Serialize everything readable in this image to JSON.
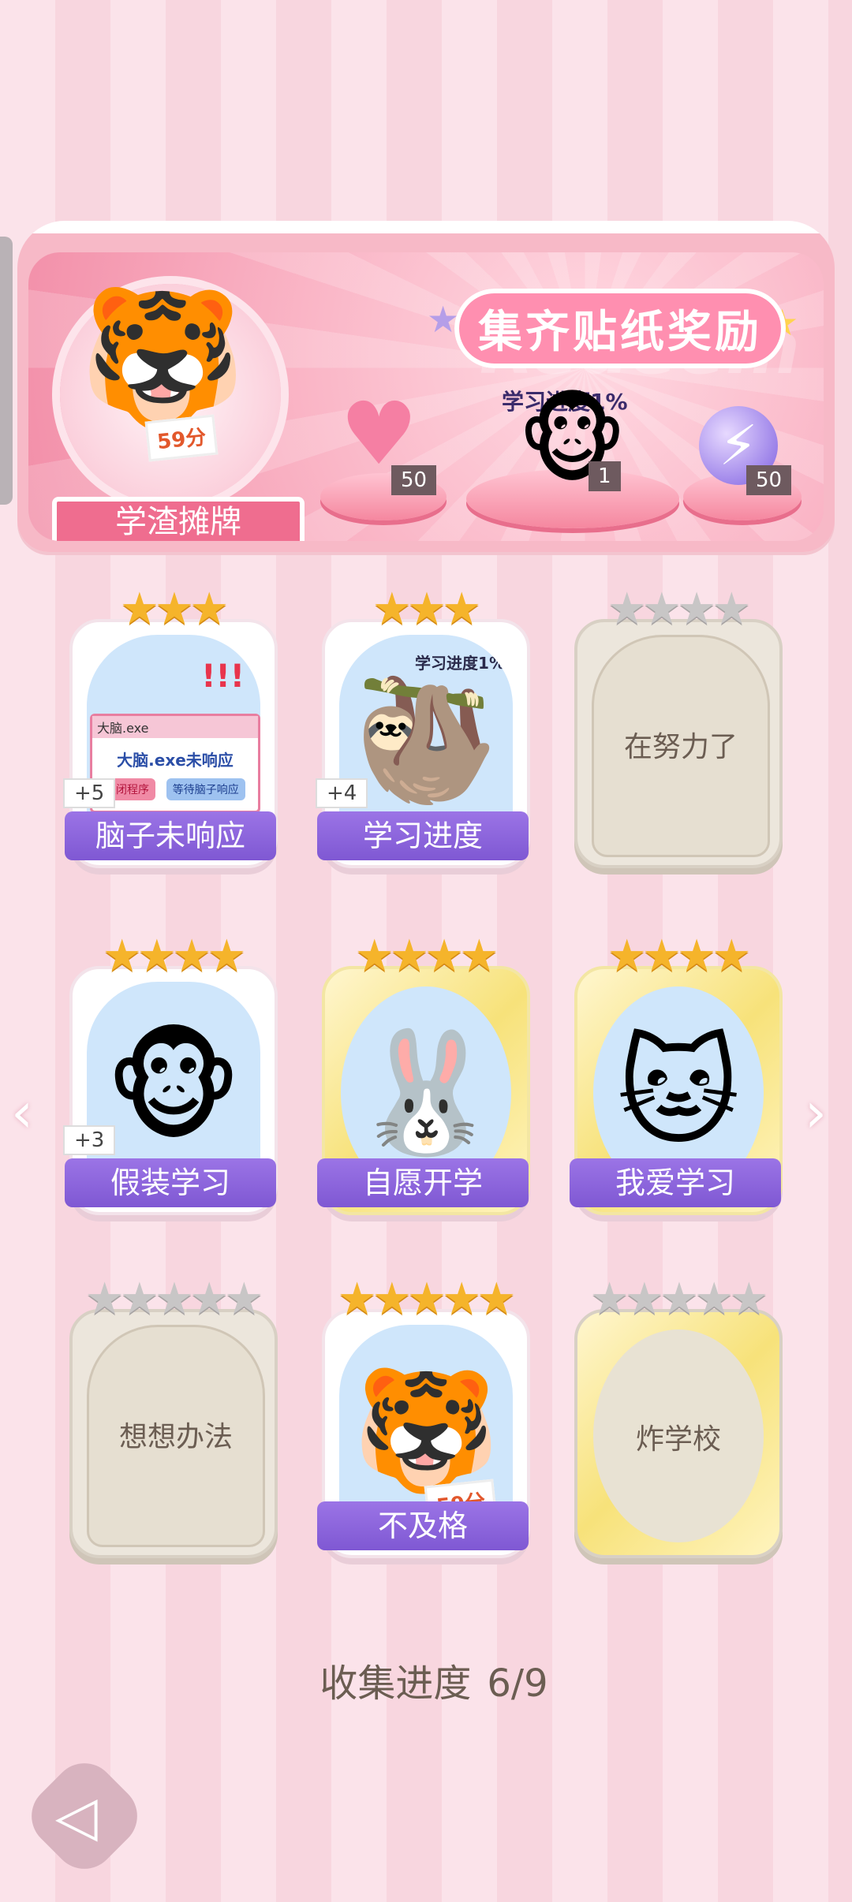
{
  "banner": {
    "title": "集齐贴纸奖励",
    "watermark": "Redeem",
    "player_name": "学渣摊牌",
    "tiger_sign": "59分",
    "progress_caption": "学习进度1%",
    "rewards": [
      {
        "icon": "heart-gem-icon",
        "count": "50"
      },
      {
        "icon": "monkey-sticker-icon",
        "count": "1"
      },
      {
        "icon": "lightning-orb-icon",
        "count": "50"
      }
    ]
  },
  "cards": [
    {
      "name": "脑子未响应",
      "stars": 3,
      "bonus": "+5",
      "locked": false,
      "window_title": "大脑.exe",
      "window_msg": "大脑.exe未响应",
      "btn_close": "关闭程序",
      "btn_wait": "等待脑子响应"
    },
    {
      "name": "学习进度",
      "stars": 3,
      "bonus": "+4",
      "locked": false,
      "caption": "学习进度1%"
    },
    {
      "name": "在努力了",
      "stars": 4,
      "locked": true
    },
    {
      "name": "假装学习",
      "stars": 4,
      "bonus": "+3",
      "locked": false
    },
    {
      "name": "自愿开学",
      "stars": 4,
      "locked": false
    },
    {
      "name": "我爱学习",
      "stars": 4,
      "locked": false
    },
    {
      "name": "想想办法",
      "stars": 5,
      "locked": true
    },
    {
      "name": "不及格",
      "stars": 5,
      "locked": false,
      "sign": "59分"
    },
    {
      "name": "炸学校",
      "stars": 5,
      "locked": true
    }
  ],
  "footer": {
    "label": "收集进度",
    "value": "6/9"
  },
  "colors": {
    "accent": "#8a62dd",
    "banner": "#f7a8bb",
    "star": "#f5b42b"
  }
}
